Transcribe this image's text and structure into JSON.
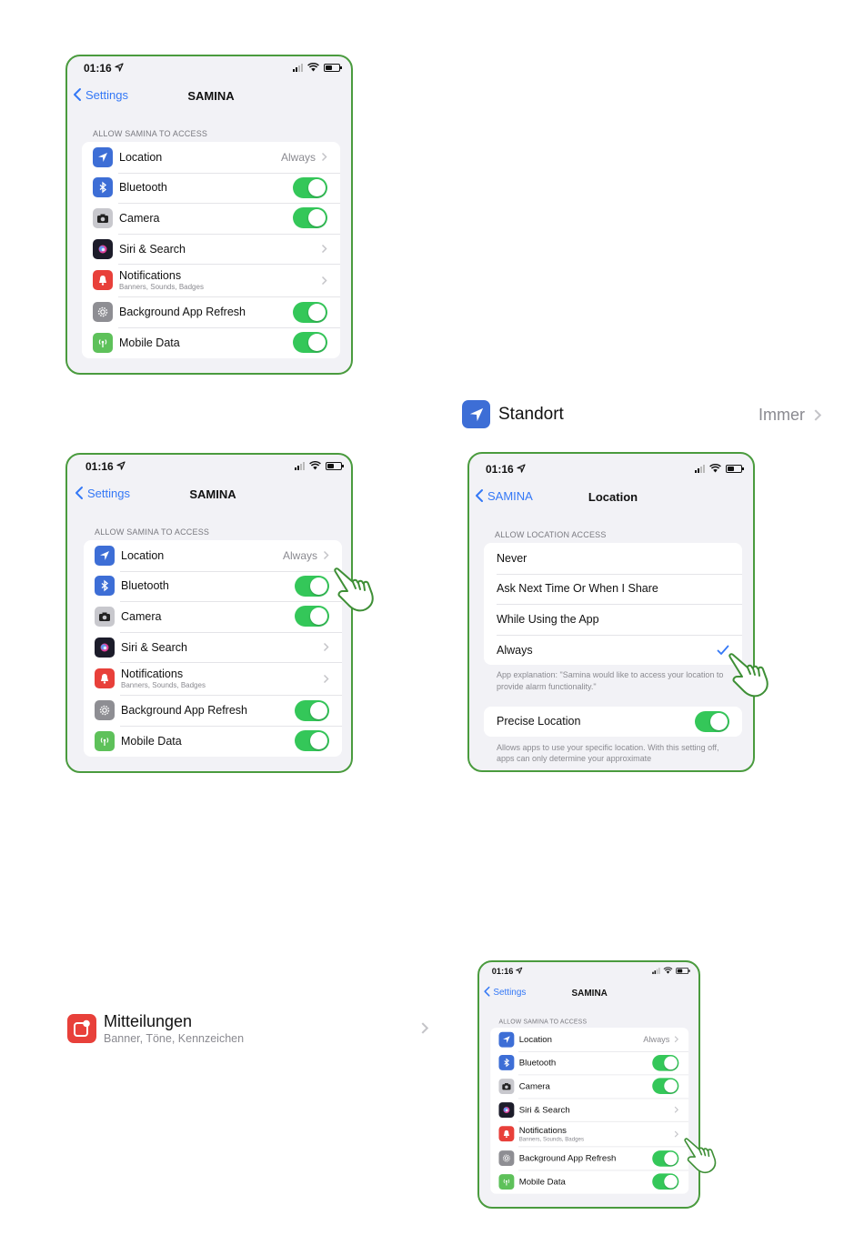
{
  "colors": {
    "frame": "#4a9b3e",
    "accent": "#3478f6",
    "toggle_on": "#34c759",
    "location_icon": "#3d6ed6",
    "bluetooth_icon": "#3d6ed6",
    "notifications_icon": "#e8403a",
    "mobile_data_icon": "#5ec15a",
    "background_refresh_icon": "#8e8e93",
    "camera_icon": "#b8b8bd"
  },
  "status": {
    "time": "01:16"
  },
  "nav": {
    "back_label": "Settings",
    "title": "SAMINA"
  },
  "app_settings": {
    "section_header": "ALLOW SAMINA TO ACCESS",
    "rows": {
      "location": {
        "label": "Location",
        "detail": "Always"
      },
      "bluetooth": {
        "label": "Bluetooth",
        "toggle": true
      },
      "camera": {
        "label": "Camera",
        "toggle": true
      },
      "siri": {
        "label": "Siri & Search"
      },
      "notifications": {
        "label": "Notifications",
        "sublabel": "Banners, Sounds, Badges"
      },
      "background_refresh": {
        "label": "Background App Refresh",
        "toggle": true
      },
      "mobile_data": {
        "label": "Mobile Data",
        "toggle": true
      }
    }
  },
  "location_screen": {
    "back_label": "SAMINA",
    "title": "Location",
    "section_header": "ALLOW LOCATION ACCESS",
    "options": [
      "Never",
      "Ask Next Time Or When I Share",
      "While Using the App",
      "Always"
    ],
    "selected": "Always",
    "explanation": "App explanation: \"Samina would like to access your location to provide alarm functionality.\"",
    "precise_label": "Precise Location",
    "precise_on": true,
    "precise_footnote": "Allows apps to use your specific location. With this setting off, apps can only determine your approximate"
  },
  "callout_standort": {
    "label": "Standort",
    "detail": "Immer",
    "icon": "location-arrow-icon"
  },
  "callout_mitteilungen": {
    "label": "Mitteilungen",
    "sublabel": "Banner, Töne, Kennzeichen",
    "icon": "notifications-icon"
  }
}
